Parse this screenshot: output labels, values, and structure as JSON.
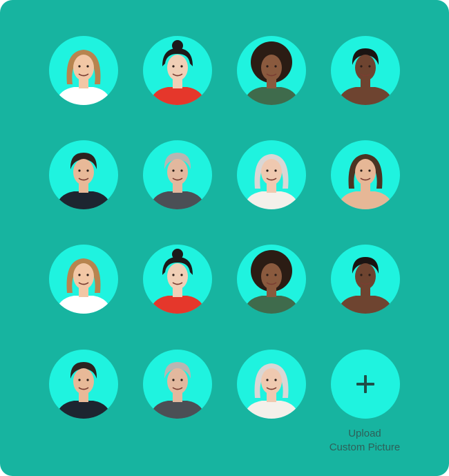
{
  "upload": {
    "label_line1": "Upload",
    "label_line2": "Custom Picture",
    "icon": "plus-icon"
  },
  "colors": {
    "panel_background": "#17b4a0",
    "circle_fill": "#1ff3df",
    "label_text": "#2e5f58"
  },
  "avatars": [
    {
      "name": "avatar-woman-blonde",
      "skin": "#f2c7a5",
      "hair": "#b7844f",
      "top": "#ffffff",
      "hair_style": "long"
    },
    {
      "name": "avatar-woman-asian",
      "skin": "#f0cfb6",
      "hair": "#1c1a1a",
      "top": "#e5372b",
      "hair_style": "bun"
    },
    {
      "name": "avatar-woman-curly",
      "skin": "#8a5a3e",
      "hair": "#2b1c14",
      "top": "#3f6b4c",
      "hair_style": "afro"
    },
    {
      "name": "avatar-man-thinking",
      "skin": "#6e4430",
      "hair": "#1a1412",
      "top": "#6e4430",
      "hair_style": "short"
    },
    {
      "name": "avatar-man-suit",
      "skin": "#e8b998",
      "hair": "#2c2320",
      "top": "#1d2530",
      "hair_style": "short"
    },
    {
      "name": "avatar-man-grey",
      "skin": "#e2b89e",
      "hair": "#b8b6b2",
      "top": "#4b4f55",
      "hair_style": "short"
    },
    {
      "name": "avatar-woman-grey",
      "skin": "#efc9b0",
      "hair": "#d9d7d5",
      "top": "#f4f0ea",
      "hair_style": "long"
    },
    {
      "name": "avatar-woman-young",
      "skin": "#e6b796",
      "hair": "#4a3423",
      "top": "#e6b796",
      "hair_style": "long"
    },
    {
      "name": "avatar-woman-blonde",
      "skin": "#f2c7a5",
      "hair": "#b7844f",
      "top": "#ffffff",
      "hair_style": "long"
    },
    {
      "name": "avatar-woman-asian",
      "skin": "#f0cfb6",
      "hair": "#1c1a1a",
      "top": "#e5372b",
      "hair_style": "bun"
    },
    {
      "name": "avatar-woman-curly",
      "skin": "#8a5a3e",
      "hair": "#2b1c14",
      "top": "#3f6b4c",
      "hair_style": "afro"
    },
    {
      "name": "avatar-man-thinking",
      "skin": "#6e4430",
      "hair": "#1a1412",
      "top": "#6e4430",
      "hair_style": "short"
    },
    {
      "name": "avatar-man-suit",
      "skin": "#e8b998",
      "hair": "#2c2320",
      "top": "#1d2530",
      "hair_style": "short"
    },
    {
      "name": "avatar-man-grey",
      "skin": "#e2b89e",
      "hair": "#b8b6b2",
      "top": "#4b4f55",
      "hair_style": "short"
    },
    {
      "name": "avatar-woman-grey",
      "skin": "#efc9b0",
      "hair": "#d9d7d5",
      "top": "#f4f0ea",
      "hair_style": "long"
    }
  ]
}
